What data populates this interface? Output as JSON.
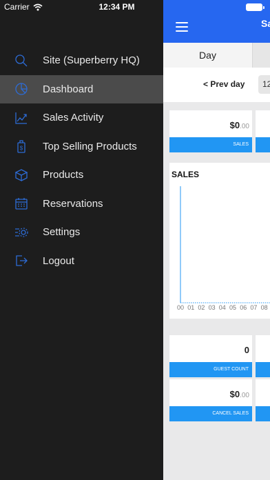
{
  "status_bar": {
    "carrier": "Carrier",
    "time": "12:34 PM"
  },
  "drawer": {
    "items": [
      {
        "label": "Site (Superberry HQ)",
        "icon": "search-icon"
      },
      {
        "label": "Dashboard",
        "icon": "pie-chart-icon",
        "active": true
      },
      {
        "label": "Sales Activity",
        "icon": "trend-chart-icon"
      },
      {
        "label": "Top Selling Products",
        "icon": "price-tag-icon"
      },
      {
        "label": "Products",
        "icon": "box-icon"
      },
      {
        "label": "Reservations",
        "icon": "calendar-icon"
      },
      {
        "label": "Settings",
        "icon": "settings-gear-icon"
      },
      {
        "label": "Logout",
        "icon": "logout-icon"
      }
    ]
  },
  "header": {
    "title": "Sa",
    "accent": "#2667f0"
  },
  "tabs": {
    "day": "Day"
  },
  "date_nav": {
    "prev": "< Prev day",
    "date": "12"
  },
  "cards": {
    "sales": {
      "value": "$0",
      "cents": ".00",
      "label": "SALES"
    },
    "guest_count": {
      "value": "0",
      "label": "GUEST COUNT"
    },
    "cancel_sales": {
      "value": "$0",
      "cents": ".00",
      "label": "CANCEL SALES"
    },
    "bar_color": "#2196f3"
  },
  "chart_data": {
    "type": "line",
    "title": "SALES",
    "categories": [
      "00",
      "01",
      "02",
      "03",
      "04",
      "05",
      "06",
      "07",
      "08"
    ],
    "values": [
      0,
      0,
      0,
      0,
      0,
      0,
      0,
      0,
      0
    ],
    "xlabel": "",
    "ylabel": "",
    "line_color": "#2196f3"
  }
}
